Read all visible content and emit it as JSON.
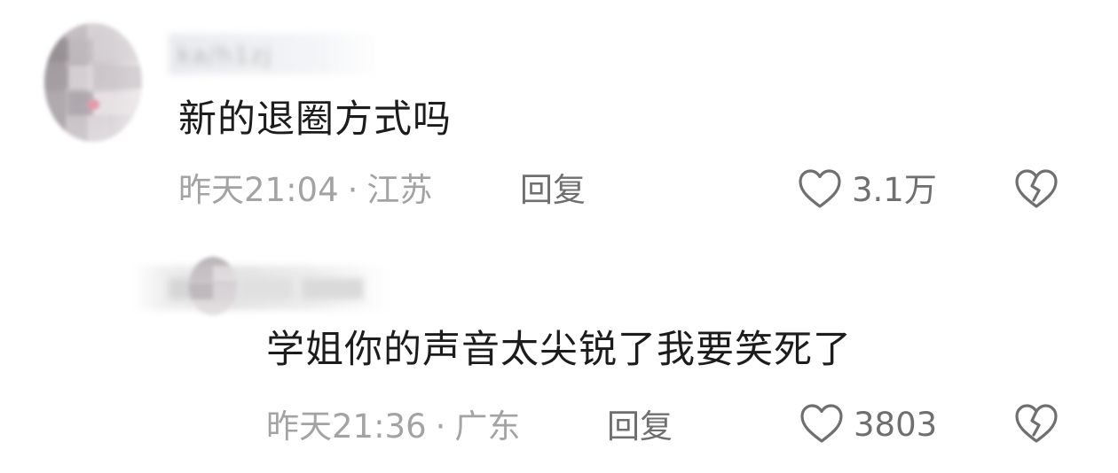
{
  "comments": [
    {
      "username": "ka/h1zj",
      "text": "新的退圈方式吗",
      "time": "昨天21:04",
      "separator": "·",
      "location": "江苏",
      "reply_label": "回复",
      "likes": "3.1万",
      "like_icon": "heart-outline-icon",
      "dislike_icon": "broken-heart-icon"
    },
    {
      "username": "",
      "text": "学姐你的声音太尖锐了我要笑死了",
      "time": "昨天21:36",
      "separator": "·",
      "location": "广东",
      "reply_label": "回复",
      "likes": "3803",
      "like_icon": "heart-outline-icon",
      "dislike_icon": "broken-heart-icon"
    }
  ],
  "colors": {
    "text_primary": "#1c1c1c",
    "text_meta": "#a3a3a3",
    "text_action": "#6f6f6f",
    "background": "#ffffff"
  }
}
